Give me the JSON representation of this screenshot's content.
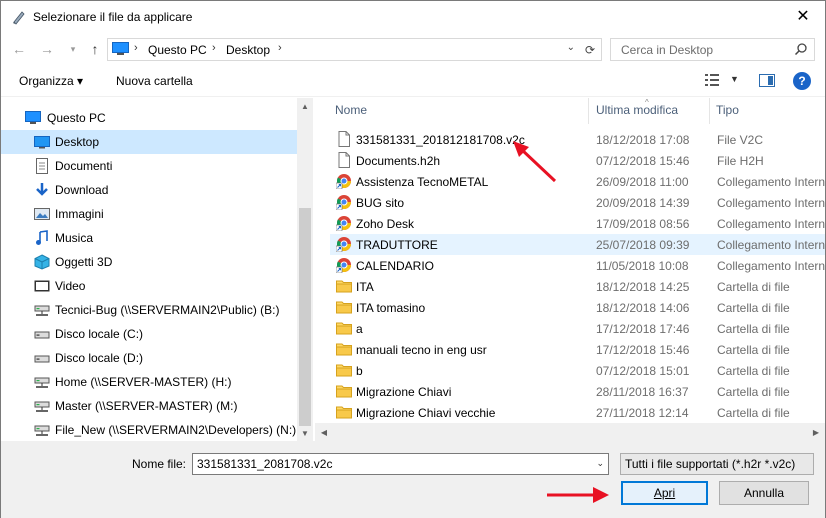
{
  "window": {
    "title": "Selezionare il file da applicare",
    "close_glyph": "✕"
  },
  "address": {
    "crumbs": [
      "Questo PC",
      "Desktop"
    ],
    "search_placeholder": "Cerca in Desktop"
  },
  "toolbar": {
    "organize": "Organizza ▾",
    "new_folder": "Nuova cartella",
    "help": "?"
  },
  "nav": {
    "items": [
      {
        "label": "Questo PC",
        "icon": "pc-icon",
        "top": true
      },
      {
        "label": "Desktop",
        "icon": "desktop-icon",
        "selected": true
      },
      {
        "label": "Documenti",
        "icon": "documents-icon"
      },
      {
        "label": "Download",
        "icon": "download-icon"
      },
      {
        "label": "Immagini",
        "icon": "pictures-icon"
      },
      {
        "label": "Musica",
        "icon": "music-icon"
      },
      {
        "label": "Oggetti 3D",
        "icon": "objects3d-icon"
      },
      {
        "label": "Video",
        "icon": "video-icon"
      },
      {
        "label": "Tecnici-Bug (\\\\SERVERMAIN2\\Public) (B:)",
        "icon": "network-drive-icon"
      },
      {
        "label": "Disco locale (C:)",
        "icon": "local-disk-icon"
      },
      {
        "label": "Disco locale (D:)",
        "icon": "local-disk-icon"
      },
      {
        "label": "Home (\\\\SERVER-MASTER) (H:)",
        "icon": "network-drive-icon"
      },
      {
        "label": "Master (\\\\SERVER-MASTER) (M:)",
        "icon": "network-drive-icon"
      },
      {
        "label": "File_New (\\\\SERVERMAIN2\\Developers) (N:)",
        "icon": "network-drive-icon"
      }
    ]
  },
  "list": {
    "columns": {
      "name": "Nome",
      "modified": "Ultima modifica",
      "type": "Tipo"
    },
    "rows": [
      {
        "name": "331581331_201812181708.v2c",
        "date": "18/12/2018 17:08",
        "type": "File V2C",
        "icon": "file-icon"
      },
      {
        "name": "Documents.h2h",
        "date": "07/12/2018 15:46",
        "type": "File H2H",
        "icon": "file-icon"
      },
      {
        "name": "Assistenza TecnoMETAL",
        "date": "26/09/2018 11:00",
        "type": "Collegamento Internet",
        "icon": "chrome-shortcut-icon"
      },
      {
        "name": "BUG sito",
        "date": "20/09/2018 14:39",
        "type": "Collegamento Internet",
        "icon": "chrome-shortcut-icon"
      },
      {
        "name": "Zoho Desk",
        "date": "17/09/2018 08:56",
        "type": "Collegamento Internet",
        "icon": "chrome-shortcut-icon"
      },
      {
        "name": "TRADUTTORE",
        "date": "25/07/2018 09:39",
        "type": "Collegamento Internet",
        "icon": "chrome-shortcut-icon",
        "hover": true
      },
      {
        "name": "CALENDARIO",
        "date": "11/05/2018 10:08",
        "type": "Collegamento Internet",
        "icon": "chrome-shortcut-icon"
      },
      {
        "name": "ITA",
        "date": "18/12/2018 14:25",
        "type": "Cartella di file",
        "icon": "folder-icon"
      },
      {
        "name": "ITA tomasino",
        "date": "18/12/2018 14:06",
        "type": "Cartella di file",
        "icon": "folder-icon"
      },
      {
        "name": "a",
        "date": "17/12/2018 17:46",
        "type": "Cartella di file",
        "icon": "folder-icon"
      },
      {
        "name": "manuali tecno in eng usr",
        "date": "17/12/2018 15:46",
        "type": "Cartella di file",
        "icon": "folder-icon"
      },
      {
        "name": "b",
        "date": "07/12/2018 15:01",
        "type": "Cartella di file",
        "icon": "folder-icon"
      },
      {
        "name": "Migrazione Chiavi",
        "date": "28/11/2018 16:37",
        "type": "Cartella di file",
        "icon": "folder-icon"
      },
      {
        "name": "Migrazione Chiavi vecchie",
        "date": "27/11/2018 12:14",
        "type": "Cartella di file",
        "icon": "folder-icon"
      }
    ]
  },
  "bottom": {
    "filename_label": "Nome file:",
    "filename_value": "331581331_2081708.v2c",
    "filetype_value": "Tutti i file supportati (*.h2r *.v2c)",
    "open_label": "Apri",
    "cancel_label": "Annulla"
  },
  "colors": {
    "selection": "#cde8ff",
    "hover": "#e5f3ff",
    "accent": "#0078d7",
    "annotation_arrow": "#e81123"
  }
}
